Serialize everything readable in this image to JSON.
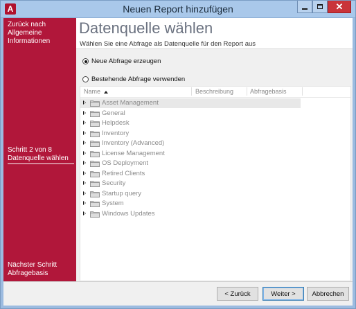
{
  "window": {
    "title": "Neuen Report hinzufügen",
    "app_icon_letter": "A"
  },
  "sidebar": {
    "back_text": "Zurück nach Allgemeine Informationen",
    "current_step": "Schritt 2 von 8",
    "current_step_name": "Datenquelle wählen",
    "next_label": "Nächster Schritt",
    "next_name": "Abfragebasis"
  },
  "header": {
    "title": "Datenquelle wählen",
    "subtitle": "Wählen Sie eine Abfrage als Datenquelle für den Report aus"
  },
  "options": {
    "new_query": "Neue Abfrage erzeugen",
    "existing_query": "Bestehende Abfrage verwenden",
    "selected": "new_query"
  },
  "list": {
    "columns": [
      "Name",
      "Beschreibung",
      "Abfragebasis"
    ],
    "sort_column": "Name",
    "items": [
      "Asset Management",
      "General",
      "Helpdesk",
      "Inventory",
      "Inventory (Advanced)",
      "License Management",
      "OS Deployment",
      "Retired Clients",
      "Security",
      "Startup query",
      "System",
      "Windows Updates"
    ],
    "selected_index": 0
  },
  "buttons": {
    "back": "< Zurück",
    "next": "Weiter >",
    "cancel": "Abbrechen"
  },
  "colors": {
    "sidebar": "#b1173a",
    "title_text": "#6b7280",
    "list_text": "#8a8a8a"
  }
}
